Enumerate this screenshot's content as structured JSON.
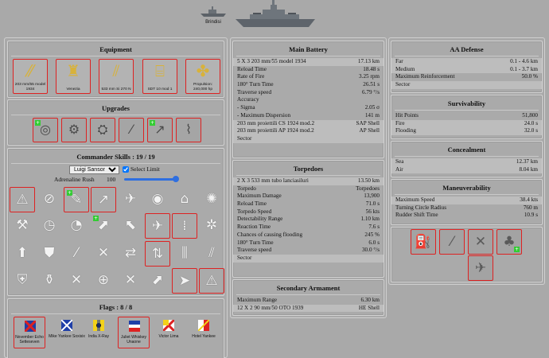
{
  "header": {
    "ship_names": [
      "Brindisi"
    ]
  },
  "equipment": {
    "title": "Equipment",
    "items": [
      {
        "label": "203 mm/55 model 1934",
        "icon": "main-battery-icon"
      },
      {
        "label": "Venezia",
        "icon": "hull-icon"
      },
      {
        "label": "533 mm Si 270 N",
        "icon": "torpedo-icon"
      },
      {
        "label": "SDT 10 mod 1",
        "icon": "fire-control-icon"
      },
      {
        "label": "Propulsion: 240,000 hp",
        "icon": "propeller-icon"
      }
    ]
  },
  "upgrades": {
    "title": "Upgrades",
    "count": 6
  },
  "commander": {
    "title": "Commander Skills : 19 / 19",
    "commander_name": "Luigi Sansonetti",
    "select_limit_label": "Select Limit",
    "adrenaline_label": "Adrenaline Rush",
    "adrenaline_value": "100"
  },
  "flags": {
    "title": "Flags : 8 / 8",
    "items": [
      {
        "label": "November Echo Setteseven",
        "selected": true
      },
      {
        "label": "Mike Yankee Soxisix",
        "selected": false
      },
      {
        "label": "India X-Ray",
        "selected": false
      },
      {
        "label": "Juliet Whiskey Unaone",
        "selected": true
      },
      {
        "label": "Victor Lima",
        "selected": false
      },
      {
        "label": "Hotel Yankee",
        "selected": false
      }
    ]
  },
  "main_battery": {
    "title": "Main Battery",
    "rows": [
      {
        "k": "5 X 3 203 mm/55 model 1934",
        "v": "17.13 km",
        "shade": true
      },
      {
        "k": "Reload Time",
        "v": "18.48 s",
        "shade": false
      },
      {
        "k": "Rate of Fire",
        "v": "3.25 rpm",
        "shade": false
      },
      {
        "k": "180° Turn Time",
        "v": "26.51 s",
        "shade": false
      },
      {
        "k": "Traverse speed",
        "v": "6.79 °/s",
        "shade": false
      },
      {
        "k": "Accuracy",
        "v": "",
        "shade": false
      },
      {
        "k": "- Sigma",
        "v": "2.05 σ",
        "shade": false
      },
      {
        "k": "- Maximum Dispersion",
        "v": "141 m",
        "shade": false
      },
      {
        "k": "203 mm proiettili CS 1924 mod.2",
        "v": "SAP Shell",
        "shade": true
      },
      {
        "k": "203 mm proiettili AP 1924 mod.2",
        "v": "AP Shell",
        "shade": true
      },
      {
        "k": "Sector",
        "v": "",
        "shade": true
      }
    ]
  },
  "torpedoes": {
    "title": "Torpedoes",
    "rows": [
      {
        "k": "2 X 3 533 mm tubo lanciasiluri",
        "v": "13.50 km",
        "shade": true
      },
      {
        "k": "Torpedo",
        "v": "Torpedoes",
        "shade": false
      },
      {
        "k": "Maximum Damage",
        "v": "13,900",
        "shade": false
      },
      {
        "k": "Reload Time",
        "v": "71.0 s",
        "shade": false
      },
      {
        "k": "Torpedo Speed",
        "v": "56 kts",
        "shade": false
      },
      {
        "k": "Detectability Range",
        "v": "1.10 km",
        "shade": false
      },
      {
        "k": "Reaction Time",
        "v": "7.6 s",
        "shade": false
      },
      {
        "k": "Chances of causing flooding",
        "v": "245 %",
        "shade": false
      },
      {
        "k": "180° Turn Time",
        "v": "6.0 s",
        "shade": false
      },
      {
        "k": "Traverse speed",
        "v": "30.0 °/s",
        "shade": false
      },
      {
        "k": "Sector",
        "v": "",
        "shade": true
      }
    ]
  },
  "secondary": {
    "title": "Secondary Armament",
    "rows": [
      {
        "k": "Maximum Range",
        "v": "6.30 km",
        "shade": false
      },
      {
        "k": "12 X 2 90 mm/50 OTO 1939",
        "v": "HE Shell",
        "shade": true
      }
    ]
  },
  "aa_defense": {
    "title": "AA Defense",
    "rows": [
      {
        "k": "Far",
        "v": "0.1 - 4.6 km",
        "shade": true
      },
      {
        "k": "Medium",
        "v": "0.1 - 3.7 km",
        "shade": true
      },
      {
        "k": "Maximum Reinforcement",
        "v": "50.0 %",
        "shade": false
      },
      {
        "k": "Sector",
        "v": "",
        "shade": true
      }
    ]
  },
  "survivability": {
    "title": "Survivability",
    "rows": [
      {
        "k": "Hit Points",
        "v": "51,800",
        "shade": false
      },
      {
        "k": "Fire",
        "v": "24.0 s",
        "shade": true
      },
      {
        "k": "Flooding",
        "v": "32.0 s",
        "shade": true
      }
    ]
  },
  "concealment": {
    "title": "Concealment",
    "rows": [
      {
        "k": "Sea",
        "v": "12.37 km",
        "shade": true
      },
      {
        "k": "Air",
        "v": "8.04 km",
        "shade": true
      }
    ]
  },
  "maneuverability": {
    "title": "Maneuverability",
    "rows": [
      {
        "k": "Maximum Speed",
        "v": "38.4 kts",
        "shade": true
      },
      {
        "k": "Turning Circle Radius",
        "v": "760 m",
        "shade": false
      },
      {
        "k": "Rudder Shift Time",
        "v": "10.9 s",
        "shade": false
      }
    ]
  },
  "colors": {
    "selection_border": "#dd2222",
    "panel_bg": "#aaaaaa",
    "row_shade": "#bdbdbd",
    "slider_accent": "#2f6fe0"
  }
}
